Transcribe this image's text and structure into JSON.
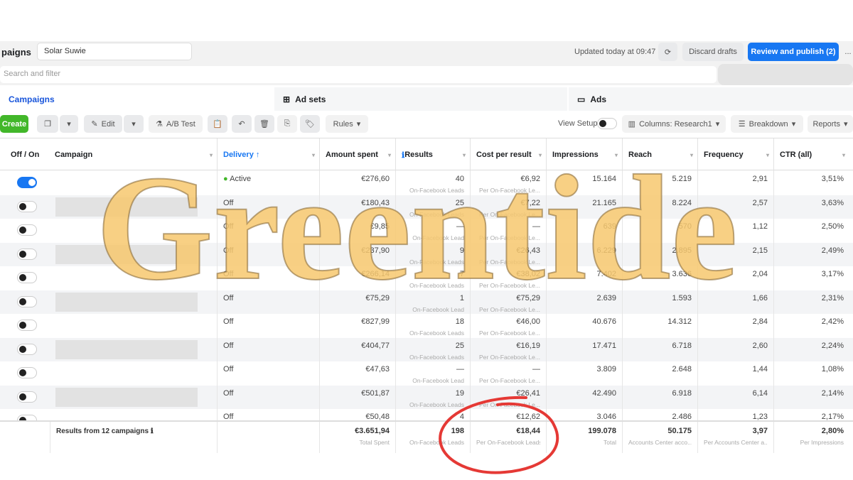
{
  "header": {
    "title": "paigns",
    "campaign_name": "Solar Suwie",
    "updated": "Updated today at 09:47",
    "discard": "Discard drafts",
    "publish": "Review and publish (2)",
    "more": "..."
  },
  "search": {
    "placeholder": "Search and filter"
  },
  "tabs": [
    {
      "label": "Campaigns"
    },
    {
      "label": "Ad sets"
    },
    {
      "label": "Ads"
    }
  ],
  "toolbar": {
    "create": "Create",
    "edit": "Edit",
    "ab_test": "A/B Test",
    "rules": "Rules",
    "view_setup": "View Setup",
    "columns": "Columns: Research1",
    "breakdown": "Breakdown",
    "reports": "Reports"
  },
  "columns": [
    "Off / On",
    "Campaign",
    "Delivery ↑",
    "Amount spent",
    "Results",
    "Cost per result",
    "Impressions",
    "Reach",
    "Frequency",
    "CTR (all)"
  ],
  "rows": [
    {
      "on": true,
      "delivery": "Active",
      "spent": "€276,60",
      "results": "40",
      "results_sub": "On-Facebook Leads",
      "cpr": "€6,92",
      "cpr_sub": "Per On-Facebook Le...",
      "impr": "15.164",
      "reach": "5.219",
      "freq": "2,91",
      "ctr": "3,51%"
    },
    {
      "on": false,
      "delivery": "Off",
      "spent": "€180,43",
      "results": "25",
      "results_sub": "On-Facebook Leads",
      "cpr": "€7,22",
      "cpr_sub": "Per On-Facebook Le...",
      "impr": "21.165",
      "reach": "8.224",
      "freq": "2,57",
      "ctr": "3,63%"
    },
    {
      "on": false,
      "delivery": "Off",
      "spent": "€9,85",
      "results": "—",
      "results_sub": "On-Facebook Lead",
      "cpr": "—",
      "cpr_sub": "Per On-Facebook Le...",
      "impr": "639",
      "reach": "570",
      "freq": "1,12",
      "ctr": "2,50%"
    },
    {
      "on": false,
      "delivery": "Off",
      "spent": "€237,90",
      "results": "9",
      "results_sub": "On-Facebook Leads",
      "cpr": "€26,43",
      "cpr_sub": "Per On-Facebook Le...",
      "impr": "6.229",
      "reach": "2.895",
      "freq": "2,15",
      "ctr": "2,49%"
    },
    {
      "on": false,
      "delivery": "Off",
      "spent": "€266,14",
      "results": "7",
      "results_sub": "On-Facebook Leads",
      "cpr": "€38,02",
      "cpr_sub": "Per On-Facebook Le...",
      "impr": "7.402",
      "reach": "3.636",
      "freq": "2,04",
      "ctr": "3,17%"
    },
    {
      "on": false,
      "delivery": "Off",
      "spent": "€75,29",
      "results": "1",
      "results_sub": "On-Facebook Lead",
      "cpr": "€75,29",
      "cpr_sub": "Per On-Facebook Le...",
      "impr": "2.639",
      "reach": "1.593",
      "freq": "1,66",
      "ctr": "2,31%"
    },
    {
      "on": false,
      "delivery": "Off",
      "spent": "€827,99",
      "results": "18",
      "results_sub": "On-Facebook Leads",
      "cpr": "€46,00",
      "cpr_sub": "Per On-Facebook Le...",
      "impr": "40.676",
      "reach": "14.312",
      "freq": "2,84",
      "ctr": "2,42%"
    },
    {
      "on": false,
      "delivery": "Off",
      "spent": "€404,77",
      "results": "25",
      "results_sub": "On-Facebook Leads",
      "cpr": "€16,19",
      "cpr_sub": "Per On-Facebook Le...",
      "impr": "17.471",
      "reach": "6.718",
      "freq": "2,60",
      "ctr": "2,24%"
    },
    {
      "on": false,
      "delivery": "Off",
      "spent": "€47,63",
      "results": "—",
      "results_sub": "On-Facebook Lead",
      "cpr": "—",
      "cpr_sub": "Per On-Facebook Le...",
      "impr": "3.809",
      "reach": "2.648",
      "freq": "1,44",
      "ctr": "1,08%"
    },
    {
      "on": false,
      "delivery": "Off",
      "spent": "€501,87",
      "results": "19",
      "results_sub": "On-Facebook Leads",
      "cpr": "€26,41",
      "cpr_sub": "Per On-Facebook Le...",
      "impr": "42.490",
      "reach": "6.918",
      "freq": "6,14",
      "ctr": "2,14%"
    },
    {
      "on": false,
      "delivery": "Off",
      "spent": "€50,48",
      "results": "4",
      "results_sub": "",
      "cpr": "€12,62",
      "cpr_sub": "",
      "impr": "3.046",
      "reach": "2.486",
      "freq": "1,23",
      "ctr": "2,17%"
    }
  ],
  "totals": {
    "label": "Results from 12 campaigns",
    "spent": "€3.651,94",
    "spent_sub": "Total Spent",
    "results": "198",
    "results_sub": "On-Facebook Leads",
    "cpr": "€18,44",
    "cpr_sub": "Per On-Facebook Leads",
    "impr": "199.078",
    "impr_sub": "Total",
    "reach": "50.175",
    "reach_sub": "Accounts Center acco...",
    "freq": "3,97",
    "freq_sub": "Per Accounts Center a...",
    "ctr": "2,80%",
    "ctr_sub": "Per Impressions"
  },
  "watermark": "Greentide",
  "colors": {
    "accent": "#1877f2",
    "create": "#42b72a",
    "annotation": "#e53935",
    "watermark": "#f7c86e"
  }
}
